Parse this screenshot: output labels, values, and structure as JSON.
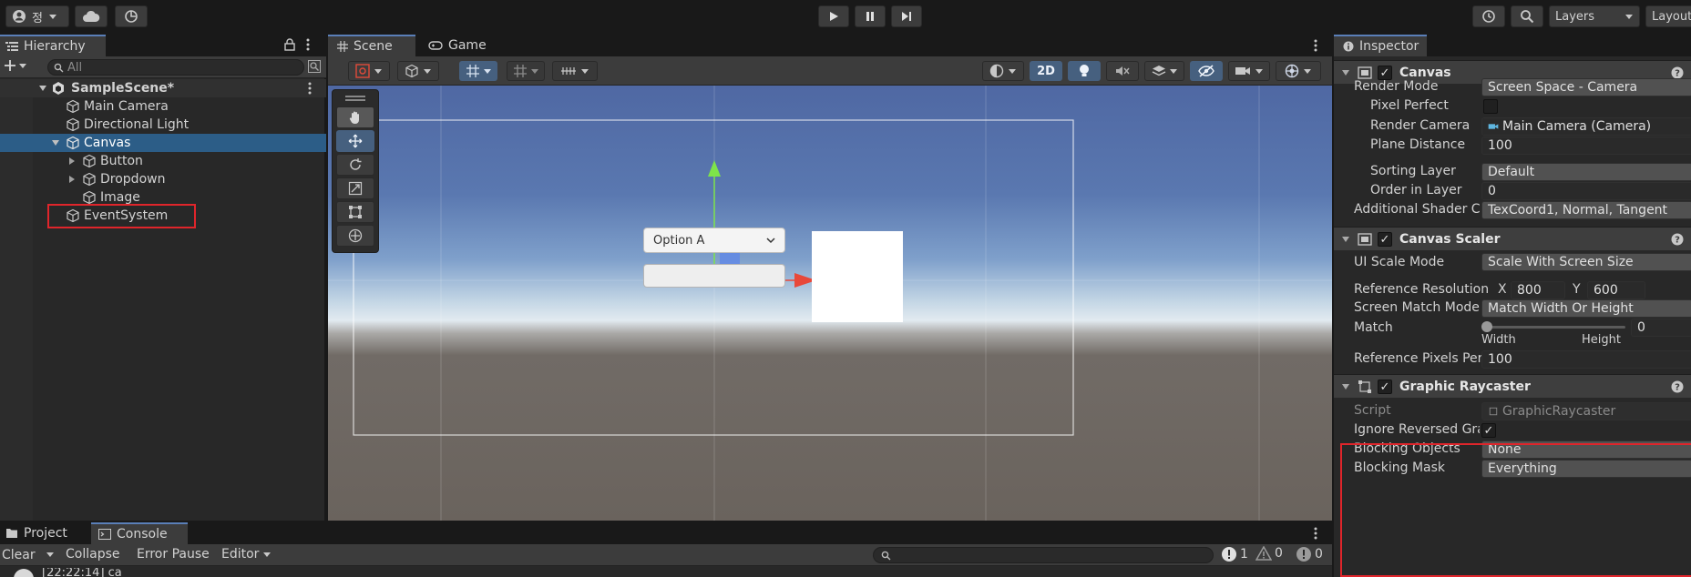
{
  "toolbar": {
    "account_label": "정",
    "layers_label": "Layers",
    "layout_label": "Layout"
  },
  "hierarchy": {
    "tab_label": "Hierarchy",
    "search_placeholder": "All",
    "scene_name": "SampleScene*",
    "items": [
      {
        "label": "Main Camera"
      },
      {
        "label": "Directional Light"
      },
      {
        "label": "Canvas"
      },
      {
        "label": "Button"
      },
      {
        "label": "Dropdown"
      },
      {
        "label": "Image"
      },
      {
        "label": "EventSystem"
      }
    ]
  },
  "scene": {
    "tabs": [
      {
        "label": "Scene"
      },
      {
        "label": "Game"
      }
    ],
    "mode_2d_label": "2D",
    "dropdown_option": "Option A"
  },
  "inspector": {
    "tab_label": "Inspector",
    "canvas": {
      "title": "Canvas",
      "render_mode_label": "Render Mode",
      "render_mode_value": "Screen Space - Camera",
      "pixel_perfect_label": "Pixel Perfect",
      "render_camera_label": "Render Camera",
      "render_camera_value": "Main Camera (Camera)",
      "plane_distance_label": "Plane Distance",
      "plane_distance_value": "100",
      "sorting_layer_label": "Sorting Layer",
      "sorting_layer_value": "Default",
      "order_in_layer_label": "Order in Layer",
      "order_in_layer_value": "0",
      "shader_channels_label": "Additional Shader Cha",
      "shader_channels_value": "TexCoord1, Normal, Tangent"
    },
    "scaler": {
      "title": "Canvas Scaler",
      "ui_scale_mode_label": "UI Scale Mode",
      "ui_scale_mode_value": "Scale With Screen Size",
      "ref_resolution_label": "Reference Resolution",
      "x_label": "X",
      "x_value": "800",
      "y_label": "Y",
      "y_value": "600",
      "screen_match_label": "Screen Match Mode",
      "screen_match_value": "Match Width Or Height",
      "match_label": "Match",
      "match_value": "0",
      "width_label": "Width",
      "height_label": "Height",
      "ref_pixels_label": "Reference Pixels Per",
      "ref_pixels_value": "100"
    },
    "raycaster": {
      "title": "Graphic Raycaster",
      "script_label": "Script",
      "script_value": "GraphicRaycaster",
      "ignore_reversed_label": "Ignore Reversed Grap",
      "blocking_objects_label": "Blocking Objects",
      "blocking_objects_value": "None",
      "blocking_mask_label": "Blocking Mask",
      "blocking_mask_value": "Everything"
    }
  },
  "console": {
    "tabs": [
      {
        "label": "Project"
      },
      {
        "label": "Console"
      }
    ],
    "clear_label": "Clear",
    "collapse_label": "Collapse",
    "error_pause_label": "Error Pause",
    "editor_label": "Editor",
    "error_count": "1",
    "warning_count": "0",
    "info_count": "0",
    "log_line": "[22:22:14] ca"
  },
  "colors": {
    "accent": "#5a7fb8",
    "selection": "#2c5d87",
    "highlight_box": "#e0252b"
  }
}
